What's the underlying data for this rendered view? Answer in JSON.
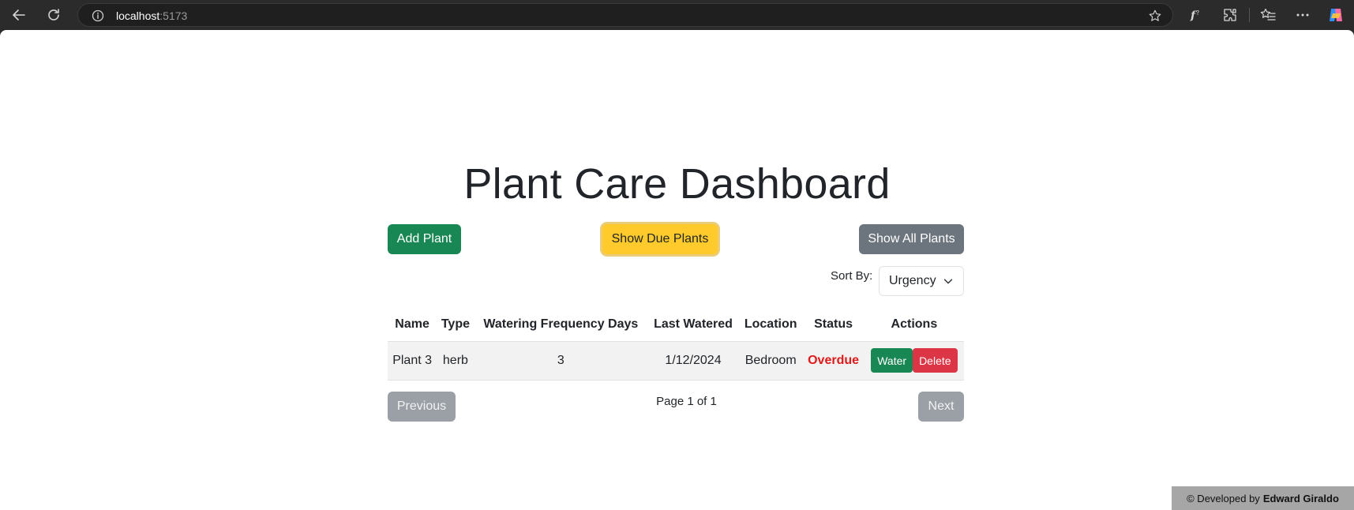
{
  "browser": {
    "url_host": "localhost",
    "url_port": ":5173"
  },
  "page": {
    "title": "Plant Care Dashboard"
  },
  "toolbar": {
    "add_label": "Add Plant",
    "due_label": "Show Due Plants",
    "all_label": "Show All Plants"
  },
  "sort": {
    "label": "Sort By:",
    "selected": "Urgency"
  },
  "table": {
    "headers": [
      "Name",
      "Type",
      "Watering Frequency Days",
      "Last Watered",
      "Location",
      "Status",
      "Actions"
    ],
    "rows": [
      {
        "name": "Plant 3",
        "type": "herb",
        "frequency": "3",
        "last_watered": "1/12/2024",
        "location": "Bedroom",
        "status": "Overdue",
        "water_label": "Water",
        "delete_label": "Delete"
      }
    ]
  },
  "pagination": {
    "prev_label": "Previous",
    "info": "Page 1 of 1",
    "next_label": "Next"
  },
  "footer": {
    "prefix": "© Developed by",
    "author": "Edward Giraldo"
  },
  "colors": {
    "success": "#198754",
    "warning": "#ffca2c",
    "secondary": "#6c757d",
    "danger": "#dc3545",
    "overdue": "#e01919"
  }
}
